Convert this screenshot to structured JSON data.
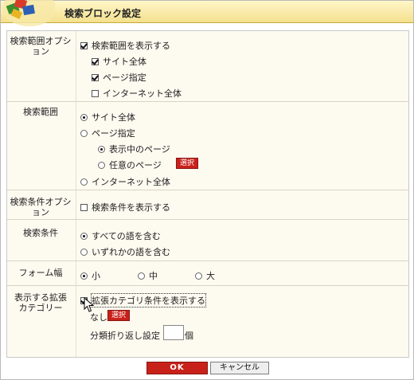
{
  "window": {
    "title": "検索ブロック設定"
  },
  "rows": {
    "option": {
      "label": "検索範囲オプション",
      "show_range": "検索範囲を表示する",
      "site_all": "サイト全体",
      "page_spec": "ページ指定",
      "internet_all": "インターネット全体"
    },
    "range": {
      "label": "検索範囲",
      "site_all": "サイト全体",
      "page_spec": "ページ指定",
      "current_page": "表示中のページ",
      "any_page": "任意のページ",
      "select_btn": "選択",
      "internet_all": "インターネット全体"
    },
    "cond_option": {
      "label": "検索条件オプション",
      "show_cond": "検索条件を表示する"
    },
    "cond": {
      "label": "検索条件",
      "all_words": "すべての語を含む",
      "any_word": "いずれかの語を含む"
    },
    "form_width": {
      "label": "フォーム幅",
      "small": "小",
      "medium": "中",
      "large": "大"
    },
    "category": {
      "label": "表示する拡張カテゴリー",
      "show_ext": "拡張カテゴリ条件を表示する",
      "none": "なし",
      "select_btn": "選択",
      "wrap_setting": "分類折り返し設定",
      "unit": "個",
      "wrap_value": ""
    }
  },
  "buttons": {
    "ok": "OK",
    "cancel": "キャンセル"
  },
  "colors": {
    "accent_red": "#c8211a",
    "title_bg": "#f4e08e",
    "panel_bg": "#fdfaf0"
  },
  "state": {
    "show_range": true,
    "site_all_cb": true,
    "page_spec_cb": true,
    "internet_all_cb": false,
    "range_selected": "site_all",
    "page_sub_selected": "current_page",
    "show_cond": false,
    "cond_selected": "all_words",
    "width_selected": "small",
    "show_ext": true
  }
}
